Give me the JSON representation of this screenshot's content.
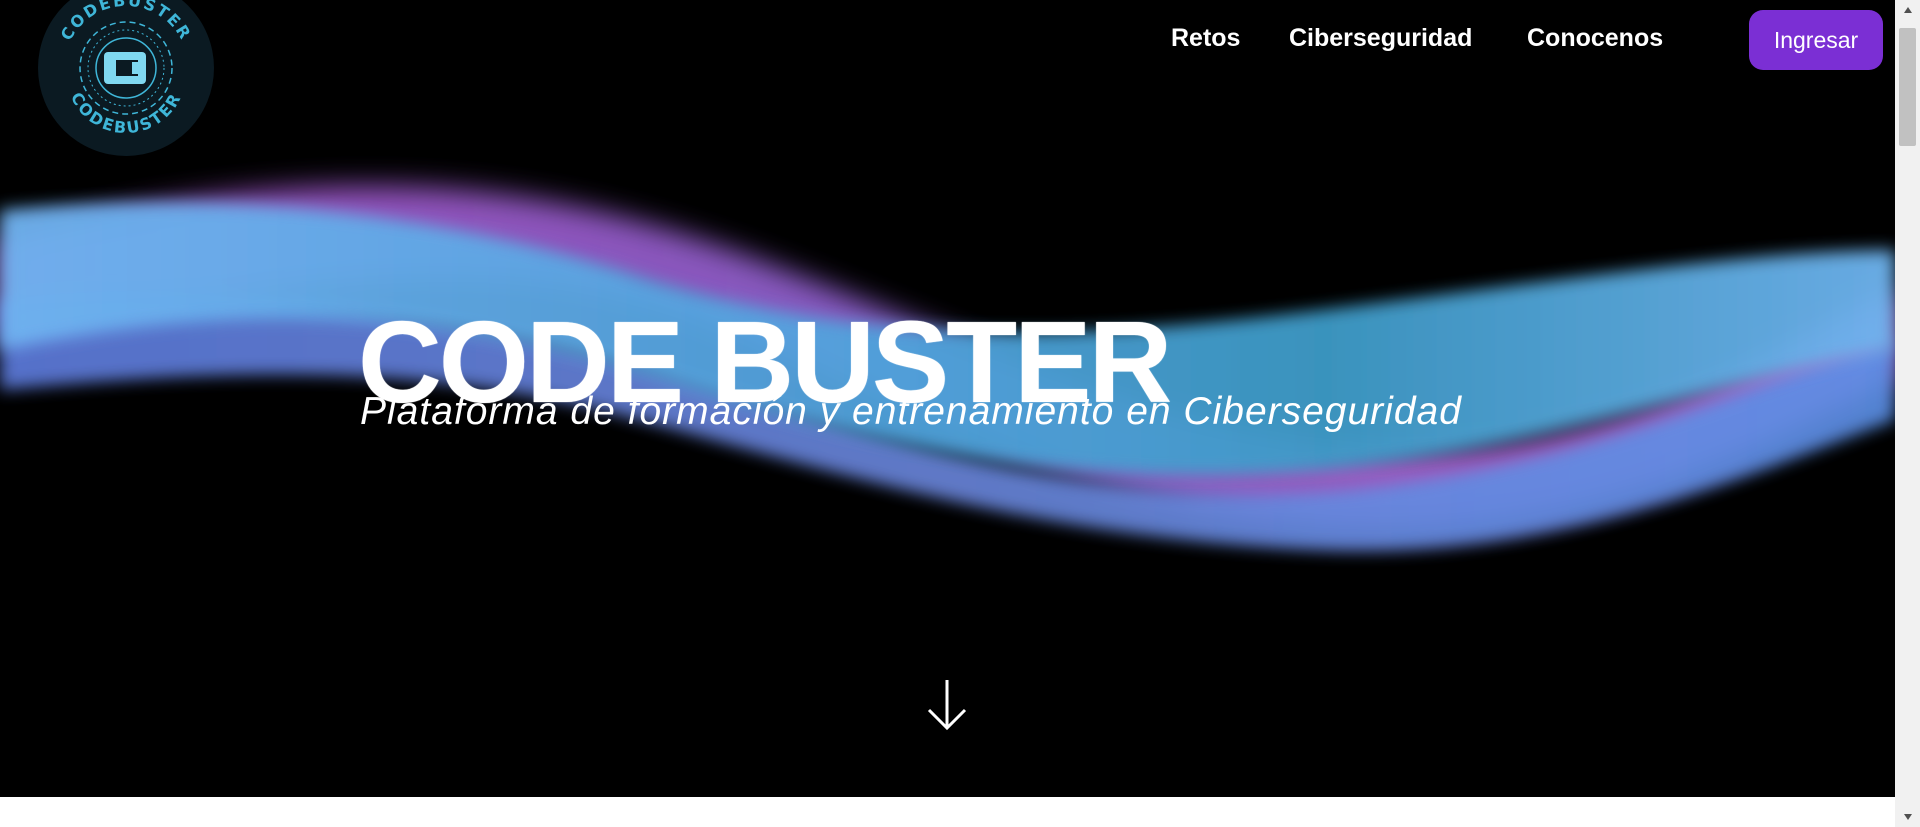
{
  "nav": {
    "links": [
      {
        "label": "Retos"
      },
      {
        "label": "Ciberseguridad"
      },
      {
        "label": "Conocenos"
      }
    ],
    "login_label": "Ingresar"
  },
  "logo": {
    "ring_text_top": "CODEBUSTER",
    "ring_text_bottom": "CODEBUSTER"
  },
  "hero": {
    "title": "CODE BUSTER",
    "subtitle": "Plataforma de formación y entrenamiento en Ciberseguridad"
  },
  "icons": {
    "scroll_down": "arrow-down-icon",
    "scroll_up": "triangle-up-icon",
    "scroll_bottom": "triangle-down-icon"
  },
  "colors": {
    "background": "#000000",
    "accent_button": "#7b2fd4",
    "wave_blue": "#5aa0e6",
    "wave_pink": "#c060d8",
    "logo_cyan": "#3fb6d8"
  }
}
